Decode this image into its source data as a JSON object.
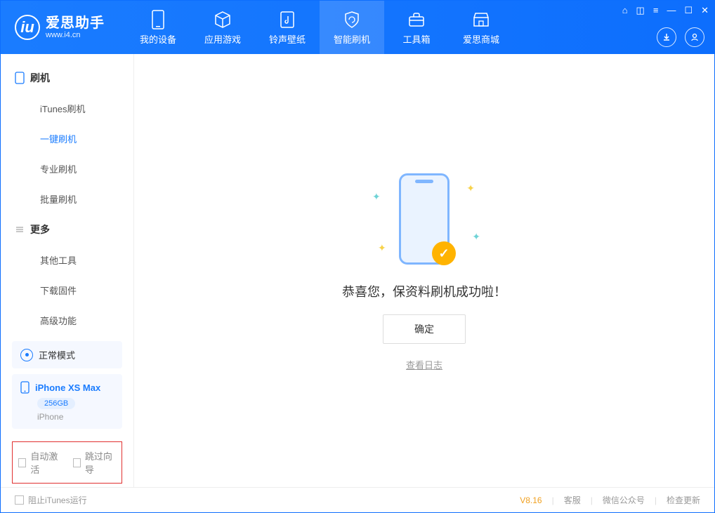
{
  "app": {
    "title": "爱思助手",
    "url": "www.i4.cn"
  },
  "tabs": [
    {
      "label": "我的设备"
    },
    {
      "label": "应用游戏"
    },
    {
      "label": "铃声壁纸"
    },
    {
      "label": "智能刷机"
    },
    {
      "label": "工具箱"
    },
    {
      "label": "爱思商城"
    }
  ],
  "sidebar": {
    "section1": "刷机",
    "items1": [
      "iTunes刷机",
      "一键刷机",
      "专业刷机",
      "批量刷机"
    ],
    "section2": "更多",
    "items2": [
      "其他工具",
      "下载固件",
      "高级功能"
    ]
  },
  "mode": {
    "label": "正常模式"
  },
  "device": {
    "name": "iPhone XS Max",
    "capacity": "256GB",
    "type": "iPhone"
  },
  "checkboxes": {
    "auto_activate": "自动激活",
    "skip_guide": "跳过向导"
  },
  "main": {
    "message": "恭喜您，保资料刷机成功啦！",
    "ok": "确定",
    "view_log": "查看日志"
  },
  "status": {
    "block_itunes": "阻止iTunes运行",
    "version": "V8.16",
    "support": "客服",
    "wechat": "微信公众号",
    "update": "检查更新"
  }
}
